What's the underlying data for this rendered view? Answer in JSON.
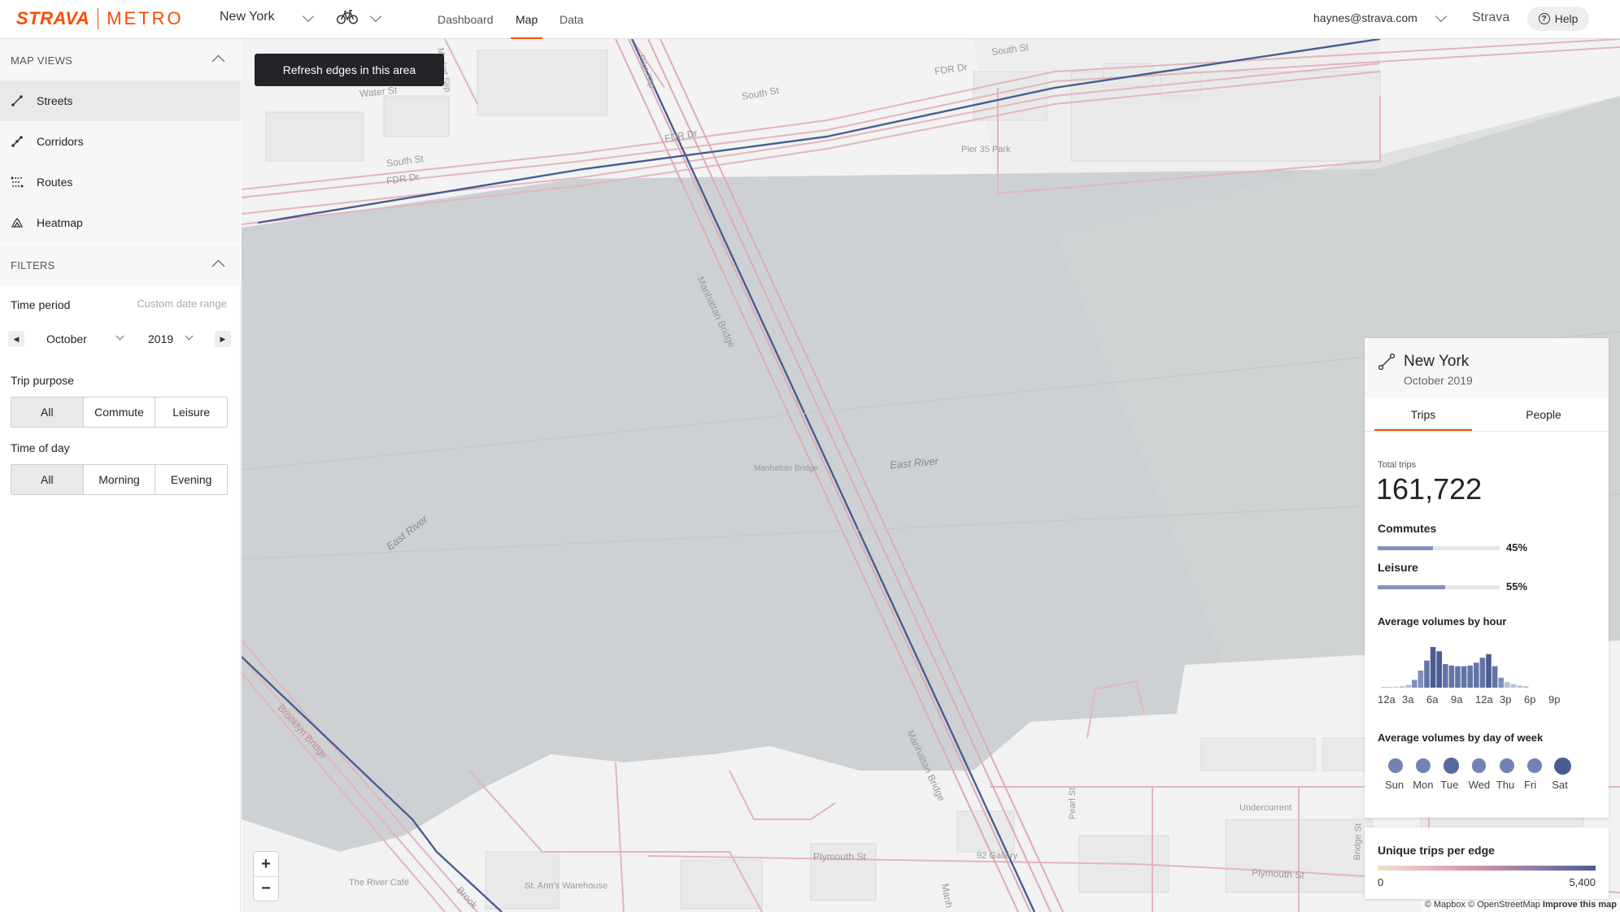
{
  "header": {
    "logo_brand": "STRAVA",
    "logo_product": "METRO",
    "city": "New York",
    "activity_icon": "bike-icon",
    "nav": [
      "Dashboard",
      "Map",
      "Data"
    ],
    "active_nav": "Map",
    "user_email": "haynes@strava.com",
    "strava_link": "Strava",
    "help": "Help"
  },
  "sidebar": {
    "map_views_title": "MAP VIEWS",
    "views": [
      {
        "label": "Streets",
        "icon": "streets-icon",
        "selected": true
      },
      {
        "label": "Corridors",
        "icon": "corridors-icon",
        "selected": false
      },
      {
        "label": "Routes",
        "icon": "routes-icon",
        "selected": false
      },
      {
        "label": "Heatmap",
        "icon": "heatmap-icon",
        "selected": false
      }
    ],
    "filters_title": "FILTERS",
    "time_period_label": "Time period",
    "custom_range": "Custom date range",
    "month": "October",
    "year": "2019",
    "trip_purpose_label": "Trip purpose",
    "trip_purpose": [
      "All",
      "Commute",
      "Leisure"
    ],
    "time_of_day_label": "Time of day",
    "time_of_day": [
      "All",
      "Morning",
      "Evening"
    ]
  },
  "map": {
    "refresh_button": "Refresh edges in this area",
    "labels": {
      "water_st": "Water St",
      "south_st_1": "South St",
      "south_st_2": "South St",
      "south_st_3": "South St",
      "fdr_1": "FDR Dr",
      "fdr_2": "FDR Dr",
      "fdr_3": "FDR Dr",
      "pier35": "Pier 35 Park",
      "manhattan_bridge_1": "Manhattan Bridge",
      "manhattan_bridge_2": "Manhattan Bridge",
      "manhattan_bridge_3": "Manhattan Bridge",
      "manhattan_bridge_4": "Manh",
      "east_river_1": "East River",
      "east_river_2": "East River",
      "brooklyn_bridge_1": "Brooklyn Bridge",
      "brooklyn_bridge_2": "Brook",
      "pike_slip": "Pike Slip",
      "market_slip": "Market Slip",
      "undercurrent": "Undercurrent",
      "pearl_st": "Pearl St",
      "bridge_st": "Bridge St",
      "plymouth_1": "Plymouth St",
      "plymouth_2": "Plymouth St",
      "gallery": "92 Gallery",
      "river_cafe": "The River Café",
      "st_anns": "St. Ann's Warehouse"
    },
    "zoom_in": "+",
    "zoom_out": "−",
    "attribution": "© Mapbox © OpenStreetMap",
    "improve": "Improve this map"
  },
  "stats": {
    "icon": "route-icon",
    "title": "New York",
    "subtitle": "October 2019",
    "tabs": [
      "Trips",
      "People"
    ],
    "active_tab": "Trips",
    "total_trips_label": "Total trips",
    "total_trips": "161,722",
    "commutes_label": "Commutes",
    "commutes_pct": "45%",
    "commutes_value": 45,
    "leisure_label": "Leisure",
    "leisure_pct": "55%",
    "leisure_value": 55,
    "hourly_title": "Average volumes by hour",
    "hour_labels": [
      "12a",
      "3a",
      "6a",
      "9a",
      "12a",
      "3p",
      "6p",
      "9p"
    ],
    "daily_title": "Average volumes by day of week",
    "day_labels": [
      "Sun",
      "Mon",
      "Tue",
      "Wed",
      "Thu",
      "Fri",
      "Sat"
    ]
  },
  "chart_data": [
    {
      "type": "bar",
      "title": "Average volumes by hour",
      "categories": [
        "12a",
        "1a",
        "2a",
        "3a",
        "4a",
        "5a",
        "6a",
        "7a",
        "8a",
        "9a",
        "10a",
        "11a",
        "12p",
        "1p",
        "2p",
        "3p",
        "4p",
        "5p",
        "6p",
        "7p",
        "8p",
        "9p",
        "10p",
        "11p"
      ],
      "values": [
        1,
        1,
        1,
        2,
        4,
        11,
        24,
        38,
        57,
        51,
        33,
        31,
        30,
        30,
        31,
        35,
        42,
        47,
        30,
        14,
        8,
        5,
        3,
        2
      ]
    },
    {
      "type": "scatter",
      "title": "Average volumes by day of week",
      "categories": [
        "Sun",
        "Mon",
        "Tue",
        "Wed",
        "Thu",
        "Fri",
        "Sat"
      ],
      "values": [
        60,
        62,
        85,
        60,
        58,
        62,
        100
      ]
    }
  ],
  "legend": {
    "title": "Unique trips per edge",
    "min": "0",
    "max": "5,400"
  }
}
